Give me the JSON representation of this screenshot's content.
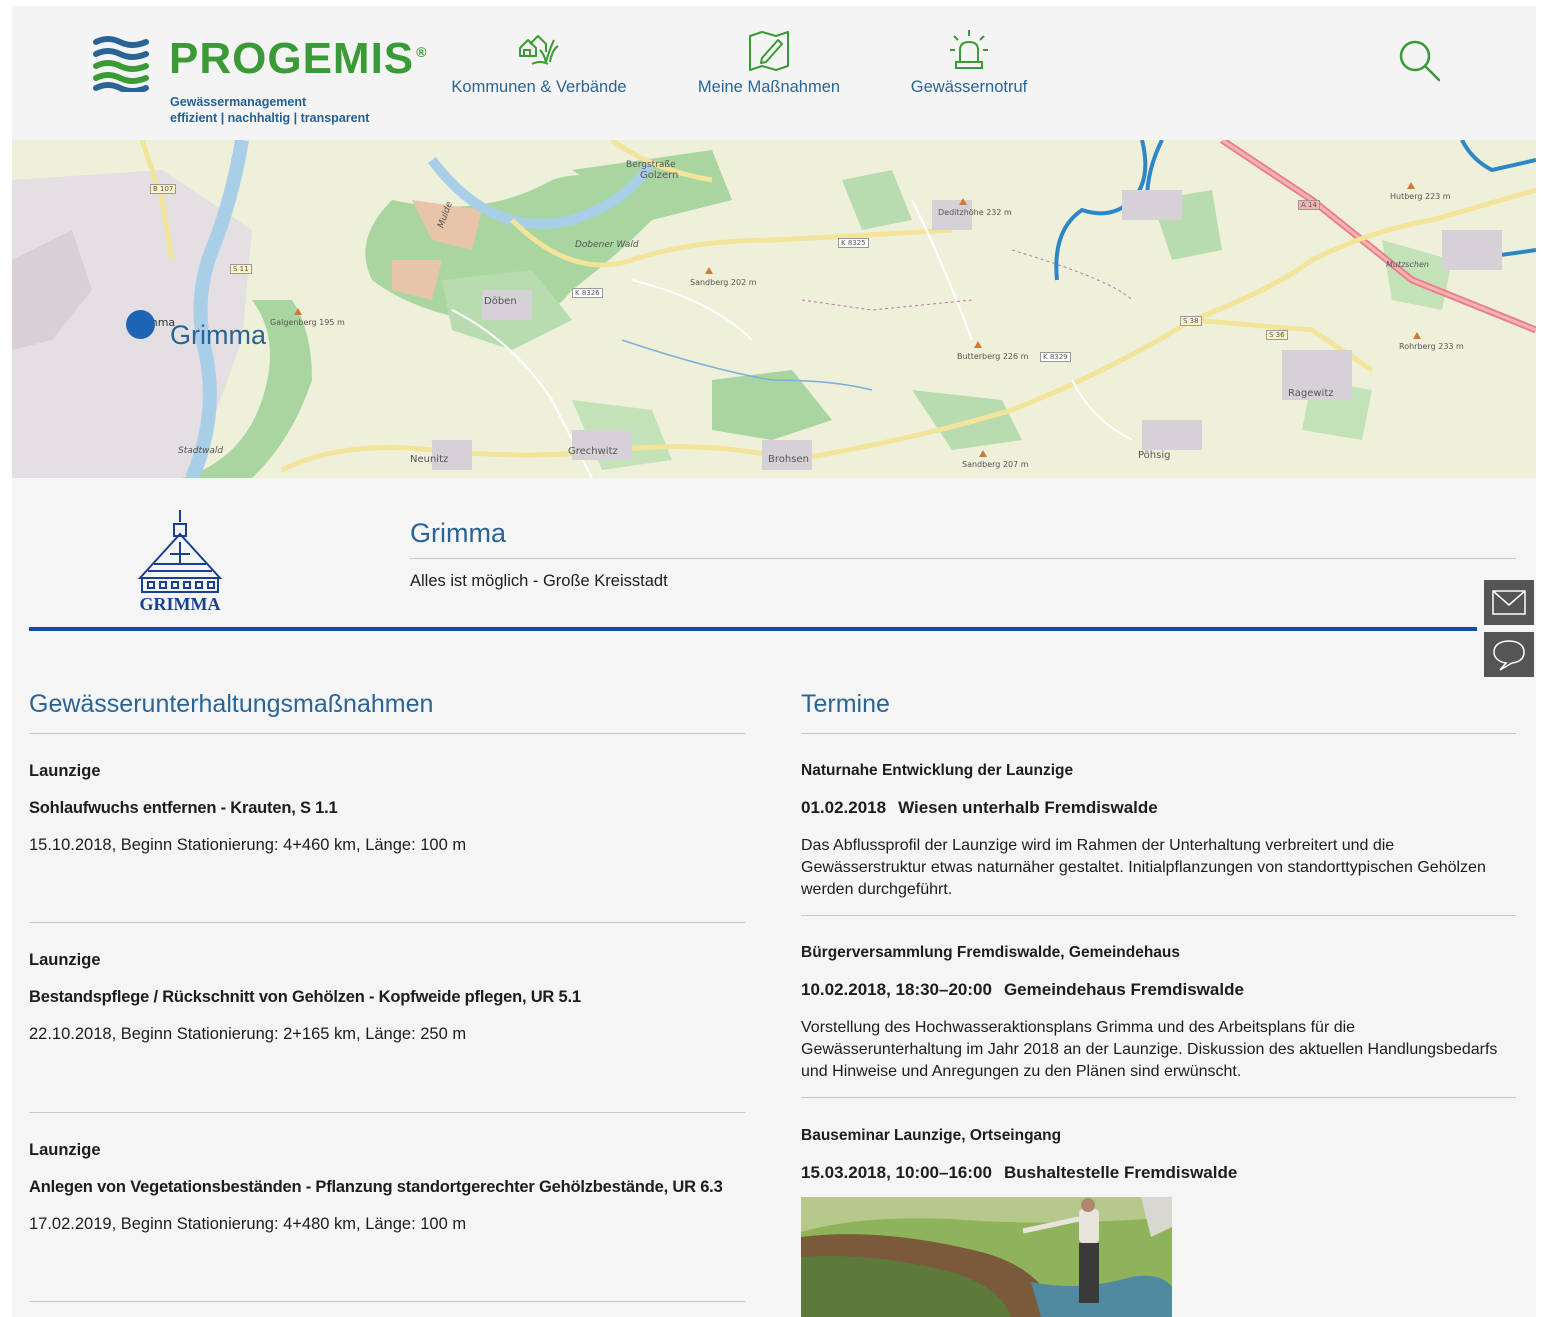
{
  "brand": {
    "name": "PROGEMIS",
    "registered": "®",
    "tagline_line1": "Gewässermanagement",
    "tagline_line2": "effizient | nachhaltig | transparent"
  },
  "nav": {
    "items": [
      {
        "label": "Kommunen & Verbände",
        "icon": "houses-plant-icon"
      },
      {
        "label": "Meine Maßnahmen",
        "icon": "map-pencil-icon"
      },
      {
        "label": "Gewässernotruf",
        "icon": "alarm-light-icon"
      }
    ],
    "search_icon": "search-icon"
  },
  "map": {
    "city_label": "Grimma",
    "place_labels": [
      "Golzern",
      "Bergstraße",
      "Dobener Wald",
      "Döben",
      "Galgenberg 195 m",
      "Sandberg 202 m",
      "Deditzhöhe 232 m",
      "Butterberg 226 m",
      "Hutberg 223 m",
      "Rohrberg 233 m",
      "Ragewitz",
      "Neunitz",
      "Grechwitz",
      "Brohsen",
      "Sandberg 207 m",
      "Pöhsig",
      "Stadtwald",
      "Mulde",
      "Mutzschen",
      "mma",
      "K 8325",
      "K 8326",
      "K 8329",
      "S 38",
      "S 36",
      "S 11",
      "B 107",
      "A 14"
    ]
  },
  "community": {
    "crest_text": "GRIMMA",
    "name": "Grimma",
    "subtitle": "Alles ist möglich - Große Kreisstadt"
  },
  "side_actions": [
    {
      "icon": "mail-icon"
    },
    {
      "icon": "chat-icon"
    }
  ],
  "measures": {
    "title": "Gewässerunterhaltungsmaßnahmen",
    "items": [
      {
        "river": "Launzige",
        "title": "Sohlaufwuchs entfernen - Krauten, S 1.1",
        "meta": "15.10.2018, Beginn Stationierung: 4+460 km, Länge: 100 m"
      },
      {
        "river": "Launzige",
        "title": "Bestandspflege / Rückschnitt von Gehölzen - Kopfweide pflegen, UR 5.1",
        "meta": "22.10.2018, Beginn Stationierung: 2+165 km, Länge: 250 m"
      },
      {
        "river": "Launzige",
        "title": "Anlegen von Vegetationsbeständen - Pflanzung standortgerechter Gehölzbestände, UR 6.3",
        "meta": "17.02.2019, Beginn Stationierung: 4+480 km, Länge: 100 m"
      }
    ]
  },
  "events": {
    "title": "Termine",
    "items": [
      {
        "heading": "Naturnahe Entwicklung der Launzige",
        "date": "01.02.2018",
        "place": "Wiesen unterhalb Fremdiswalde",
        "description": "Das Abflussprofil der Launzige wird im Rahmen der Unterhaltung verbreitert und die Gewässerstruktur etwas naturnäher gestaltet. Initialpflanzungen von standorttypischen Gehölzen werden durchgeführt."
      },
      {
        "heading": "Bürgerversammlung Fremdiswalde, Gemeindehaus",
        "date": "10.02.2018, 18:30–20:00",
        "place": "Gemeindehaus Fremdiswalde",
        "description": "Vorstellung des Hochwasseraktionsplans Grimma und des Arbeitsplans für die Gewässerunterhaltung im Jahr 2018 an der Launzige. Diskussion des aktuellen Handlungsbedarfs und Hinweise und Anregungen zu den Plänen sind erwünscht."
      },
      {
        "heading": "Bauseminar Launzige, Ortseingang",
        "date": "15.03.2018, 10:00–16:00",
        "place": "Bushaltestelle Fremdiswalde",
        "description": ""
      }
    ]
  },
  "colors": {
    "brand_green": "#3a9a35",
    "brand_blue": "#2a6496",
    "accent_bar": "#1b4aa3"
  }
}
